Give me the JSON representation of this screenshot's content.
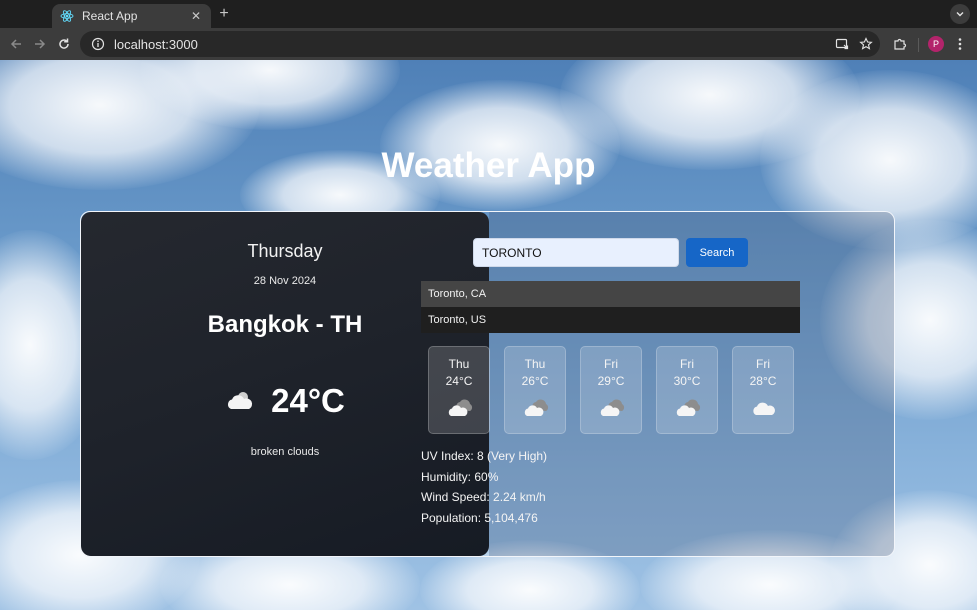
{
  "browser": {
    "tab_title": "React App",
    "url": "localhost:3000",
    "profile_initial": "P"
  },
  "app": {
    "title": "Weather App"
  },
  "current": {
    "day": "Thursday",
    "date": "28 Nov 2024",
    "city": "Bangkok - TH",
    "temp": "24°C",
    "description": "broken clouds",
    "icon": "partly-cloudy-icon"
  },
  "search": {
    "value": "TORONTO",
    "button_label": "Search"
  },
  "suggestions": [
    "Toronto, CA",
    "Toronto, US"
  ],
  "forecast": [
    {
      "day": "Thu",
      "temp": "24°C",
      "icon": "dark-cloud-icon"
    },
    {
      "day": "Thu",
      "temp": "26°C",
      "icon": "dark-cloud-icon"
    },
    {
      "day": "Fri",
      "temp": "29°C",
      "icon": "dark-cloud-icon"
    },
    {
      "day": "Fri",
      "temp": "30°C",
      "icon": "dark-cloud-icon"
    },
    {
      "day": "Fri",
      "temp": "28°C",
      "icon": "cloud-icon"
    }
  ],
  "details": {
    "uv": "UV Index: 8 (Very High)",
    "humidity": "Humidity: 60%",
    "wind": "Wind Speed: 2.24 km/h",
    "population": "Population: 5,104,476"
  },
  "colors": {
    "search_button": "#1666c7",
    "search_input_bg": "#e8f0fe",
    "left_panel": "#1f232b"
  }
}
